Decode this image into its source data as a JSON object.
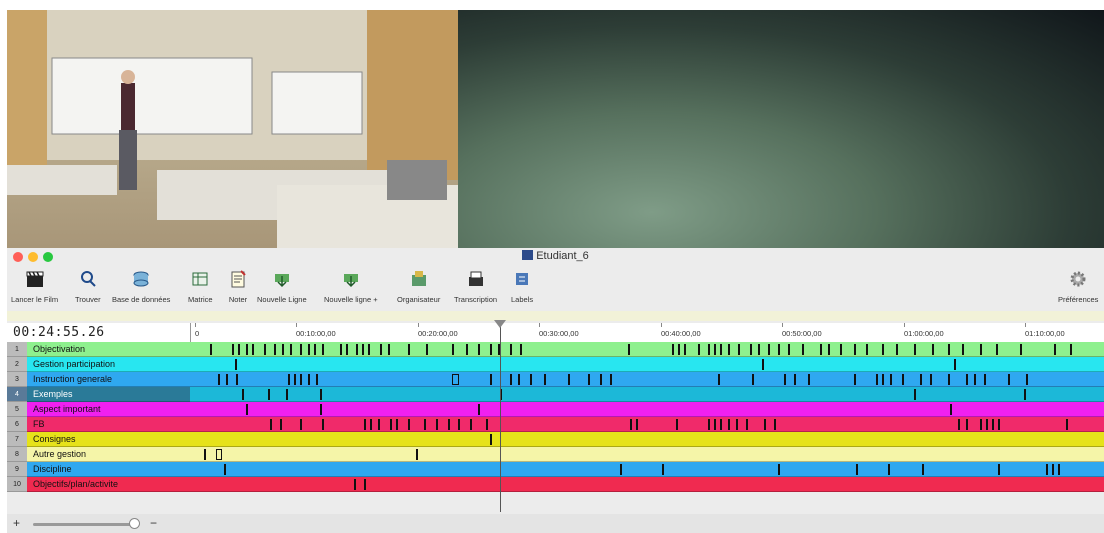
{
  "window": {
    "title": "Etudiant_6",
    "colors": {
      "close": "#ff5f57",
      "minimize": "#febc2e",
      "zoom": "#28c840"
    }
  },
  "toolbar": {
    "buttons": [
      {
        "label": "Lancer le Film",
        "icon": "clapperboard-icon"
      },
      {
        "label": "Trouver",
        "icon": "search-icon"
      },
      {
        "label": "Base de données",
        "icon": "database-icon"
      },
      {
        "label": "Matrice",
        "icon": "grid-icon"
      },
      {
        "label": "Noter",
        "icon": "notepad-icon"
      },
      {
        "label": "Nouvelle Ligne",
        "icon": "add-line-icon"
      },
      {
        "label": "Nouvelle ligne +",
        "icon": "add-line-plus-icon"
      },
      {
        "label": "Organisateur",
        "icon": "organizer-icon"
      },
      {
        "label": "Transcription",
        "icon": "typewriter-icon"
      },
      {
        "label": "Labels",
        "icon": "labels-icon"
      }
    ],
    "preferences_label": "Préférences"
  },
  "timeline": {
    "timecode": "00:24:55.26",
    "ticks": [
      "0",
      "00:10:00,00",
      "00:20:00,00",
      "00:30:00,00",
      "00:40:00,00",
      "00:50:00,00",
      "01:00:00,00",
      "01:10:00,00"
    ],
    "playhead_time": "00:24:55.26"
  },
  "tracks": [
    {
      "num": "1",
      "name": "Objectivation",
      "color": "#8ef08e"
    },
    {
      "num": "2",
      "name": "Gestion participation",
      "color": "#28e6f0"
    },
    {
      "num": "3",
      "name": "Instruction generale",
      "color": "#2fa8f0"
    },
    {
      "num": "4",
      "name": "Exemples",
      "color": "#1cb8d8",
      "selected": true
    },
    {
      "num": "5",
      "name": "Aspect important",
      "color": "#f020f0"
    },
    {
      "num": "6",
      "name": "FB",
      "color": "#f02a6a"
    },
    {
      "num": "7",
      "name": "Consignes",
      "color": "#e6e21a"
    },
    {
      "num": "8",
      "name": "Autre gestion",
      "color": "#f5f5a8"
    },
    {
      "num": "9",
      "name": "Discipline",
      "color": "#2fa8f0"
    },
    {
      "num": "10",
      "name": "Objectifs/plan/activite",
      "color": "#f02a50"
    }
  ],
  "bottom": {
    "add_label": "+",
    "remove_label": "−"
  }
}
